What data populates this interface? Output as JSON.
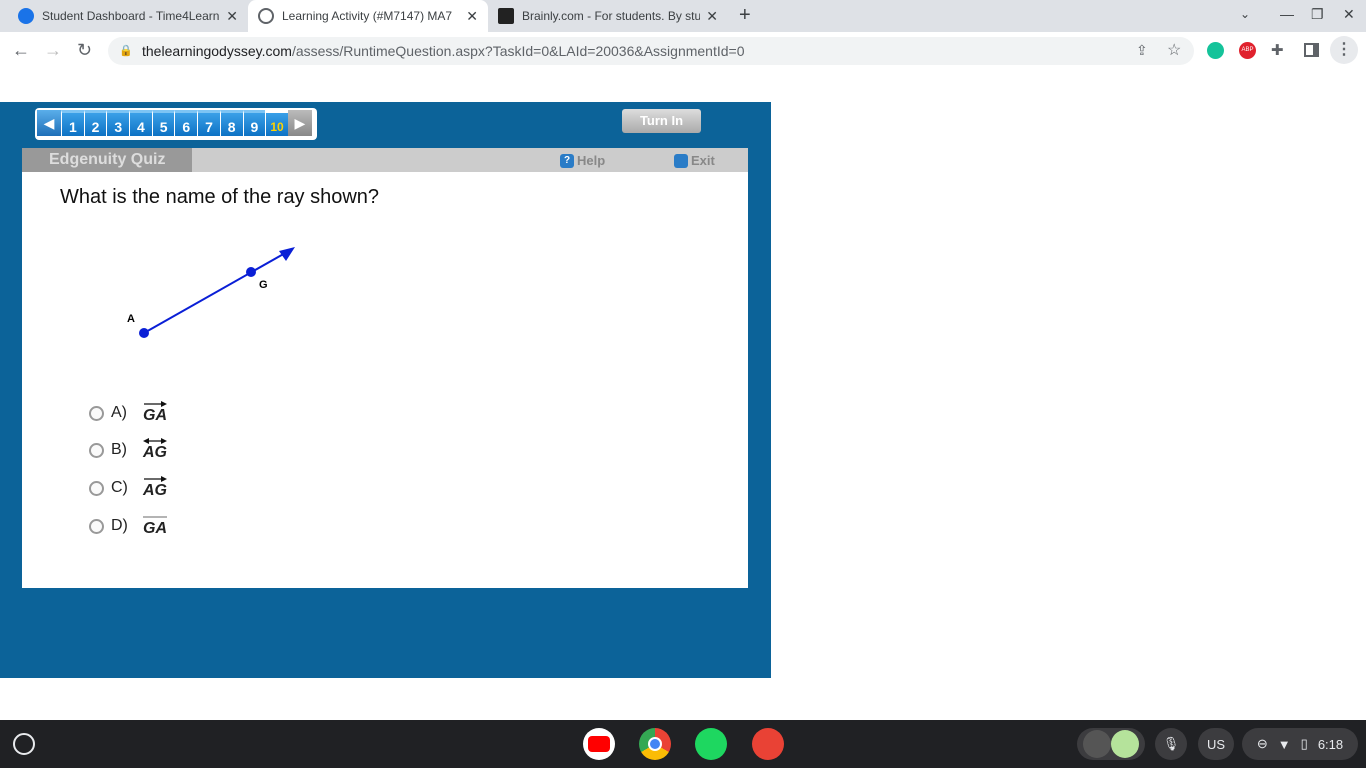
{
  "browser": {
    "tabs": [
      {
        "title": "Student Dashboard - Time4Learning",
        "active": false
      },
      {
        "title": "Learning Activity (#M7147) MA7",
        "active": true
      },
      {
        "title": "Brainly.com - For students. By students.",
        "active": false
      }
    ],
    "url_host": "thelearningodyssey.com",
    "url_path": "/assess/RuntimeQuestion.aspx?TaskId=0&LAId=20036&AssignmentId=0"
  },
  "quiz": {
    "questions": [
      "1",
      "2",
      "3",
      "4",
      "5",
      "6",
      "7",
      "8",
      "9",
      "10"
    ],
    "current": "10",
    "turn_in": "Turn In",
    "brand": "Edgenuity Quiz",
    "help": "Help",
    "exit": "Exit",
    "question": "What is the name of the ray shown?",
    "diagram": {
      "points": [
        "A",
        "G"
      ],
      "color": "#0a1fd6"
    },
    "options": [
      {
        "label": "A)",
        "name": "GA",
        "notation": "ray"
      },
      {
        "label": "B)",
        "name": "AG",
        "notation": "line"
      },
      {
        "label": "C)",
        "name": "AG",
        "notation": "ray"
      },
      {
        "label": "D)",
        "name": "GA",
        "notation": "segment"
      }
    ]
  },
  "shelf": {
    "language": "US",
    "time": "6:18"
  }
}
